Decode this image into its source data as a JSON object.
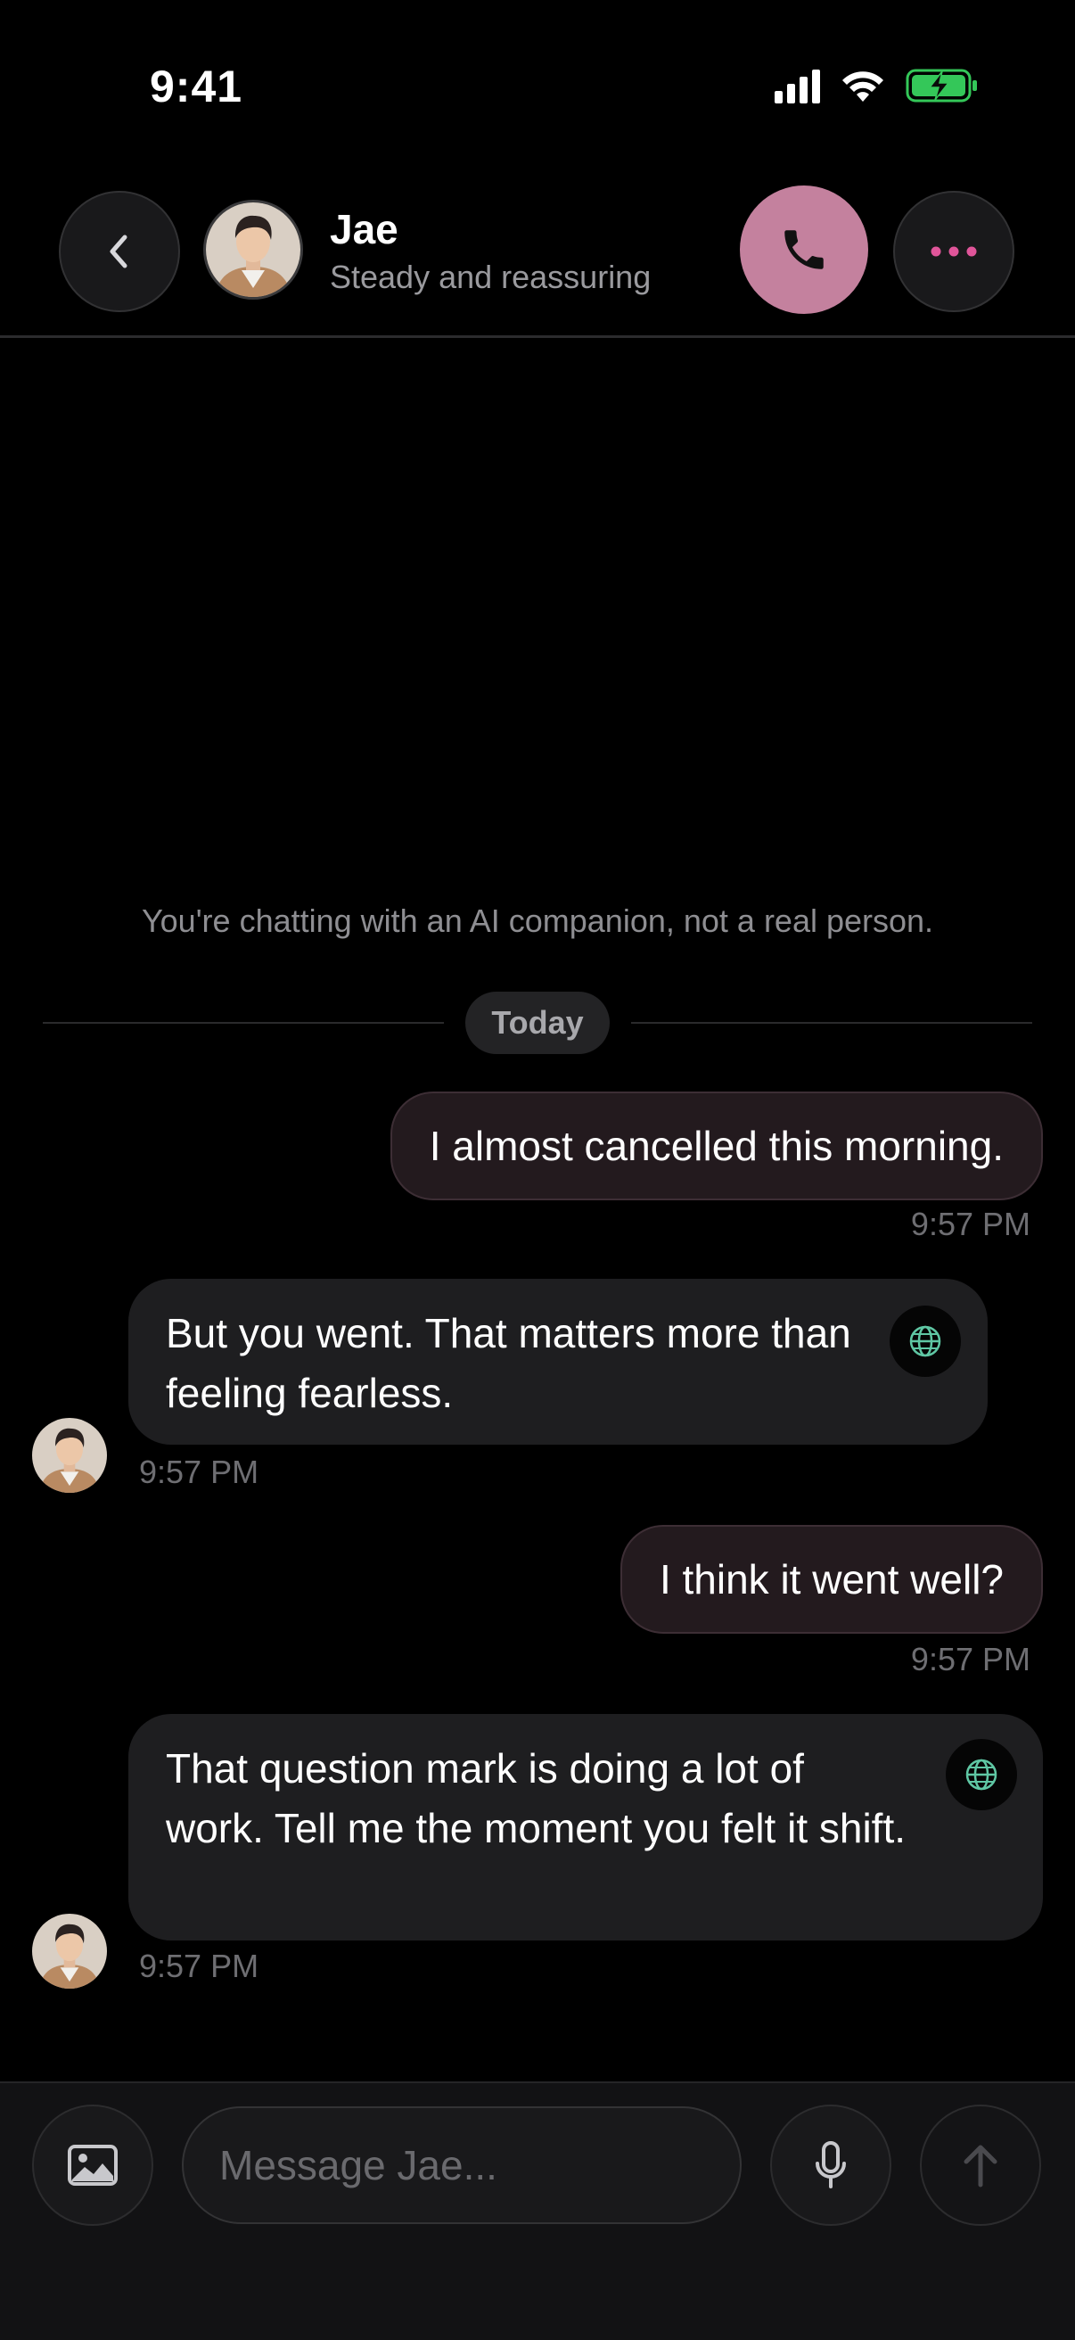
{
  "status_bar": {
    "time": "9:41"
  },
  "header": {
    "name": "Jae",
    "subtitle": "Steady and reassuring",
    "call_color": "#c4819e",
    "more_dots_color": "#e0559a"
  },
  "chat": {
    "disclaimer": "You're chatting with an AI companion, not a real person.",
    "date_divider": "Today",
    "messages": [
      {
        "sender": "me",
        "text": "I almost cancelled this morning.",
        "time": "9:57 PM"
      },
      {
        "sender": "them",
        "text": "But you went. That matters more than feeling fearless.",
        "time": "9:57 PM"
      },
      {
        "sender": "me",
        "text": "I think it went well?",
        "time": "9:57 PM"
      },
      {
        "sender": "them",
        "text": "That question mark is doing a lot of work. Tell me the moment you felt it shift.",
        "time": "9:57 PM"
      }
    ]
  },
  "composer": {
    "placeholder": "Message Jae..."
  },
  "colors": {
    "background": "#000000",
    "my_bubble": "#231a1e",
    "their_bubble": "#1e1e20",
    "battery_green": "#34c759",
    "translate_icon": "#5fc7a4"
  }
}
